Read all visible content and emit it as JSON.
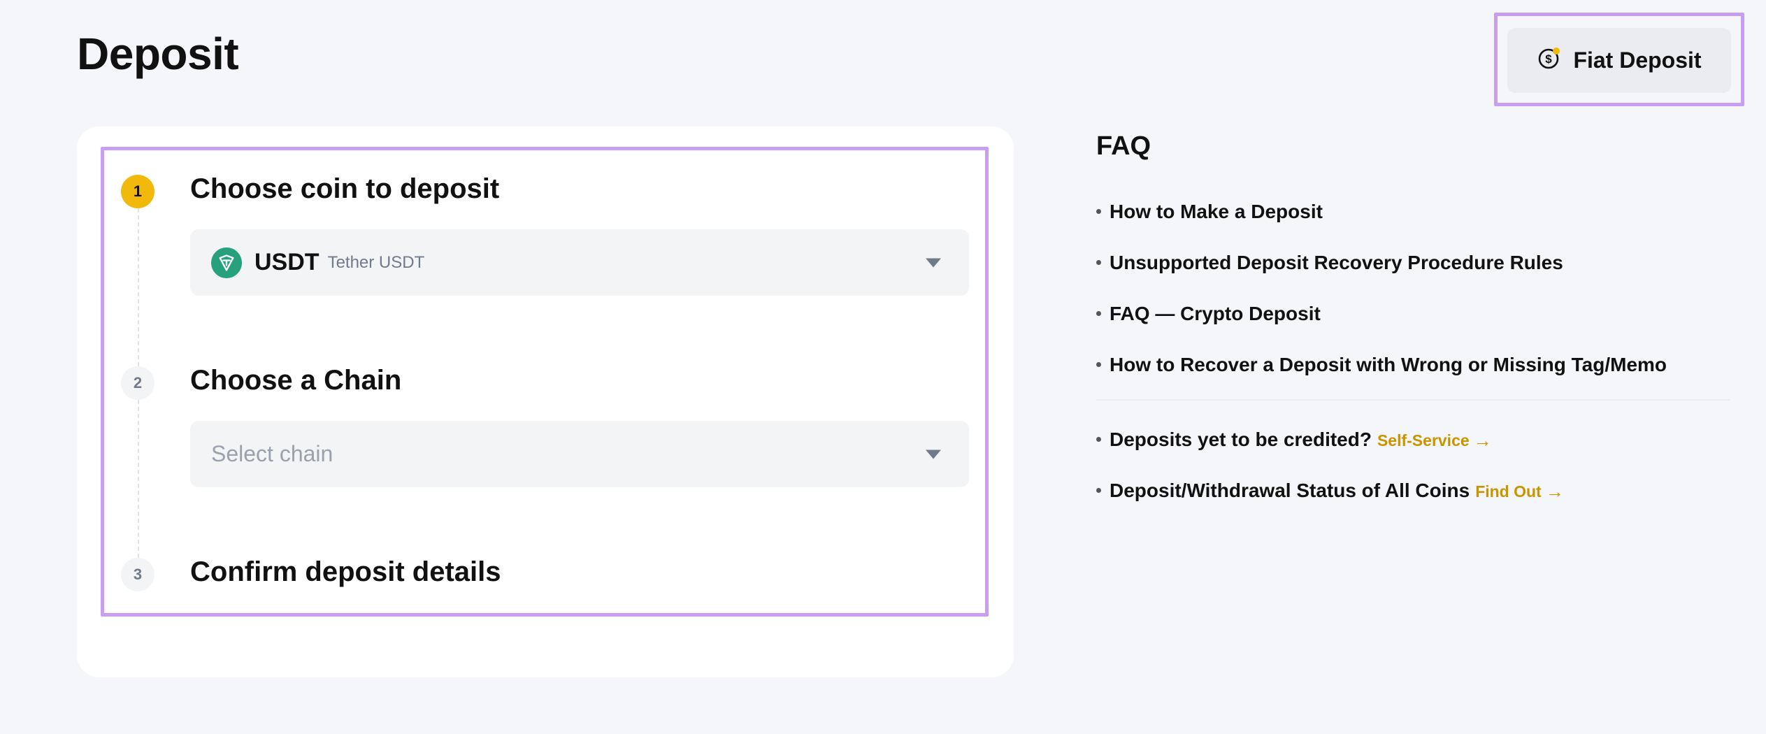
{
  "page": {
    "title": "Deposit"
  },
  "header": {
    "fiat_label": "Fiat Deposit"
  },
  "steps": [
    {
      "number": "1",
      "title": "Choose coin to deposit"
    },
    {
      "number": "2",
      "title": "Choose a Chain"
    },
    {
      "number": "3",
      "title": "Confirm deposit details"
    }
  ],
  "coin_select": {
    "symbol": "USDT",
    "name": "Tether USDT"
  },
  "chain_select": {
    "placeholder": "Select chain"
  },
  "faq": {
    "title": "FAQ",
    "items": [
      "How to Make a Deposit",
      "Unsupported Deposit Recovery Procedure Rules",
      "FAQ — Crypto Deposit",
      "How to Recover a Deposit with Wrong or Missing Tag/Memo"
    ],
    "extra": [
      {
        "text": "Deposits yet to be credited?",
        "link": "Self-Service",
        "arrow": "→"
      },
      {
        "text": "Deposit/Withdrawal Status of All Coins",
        "link": "Find Out",
        "arrow": "→"
      }
    ]
  },
  "colors": {
    "accent": "#f0b90b",
    "link": "#c99400",
    "tether": "#26a17b",
    "highlight": "#c89df2"
  }
}
